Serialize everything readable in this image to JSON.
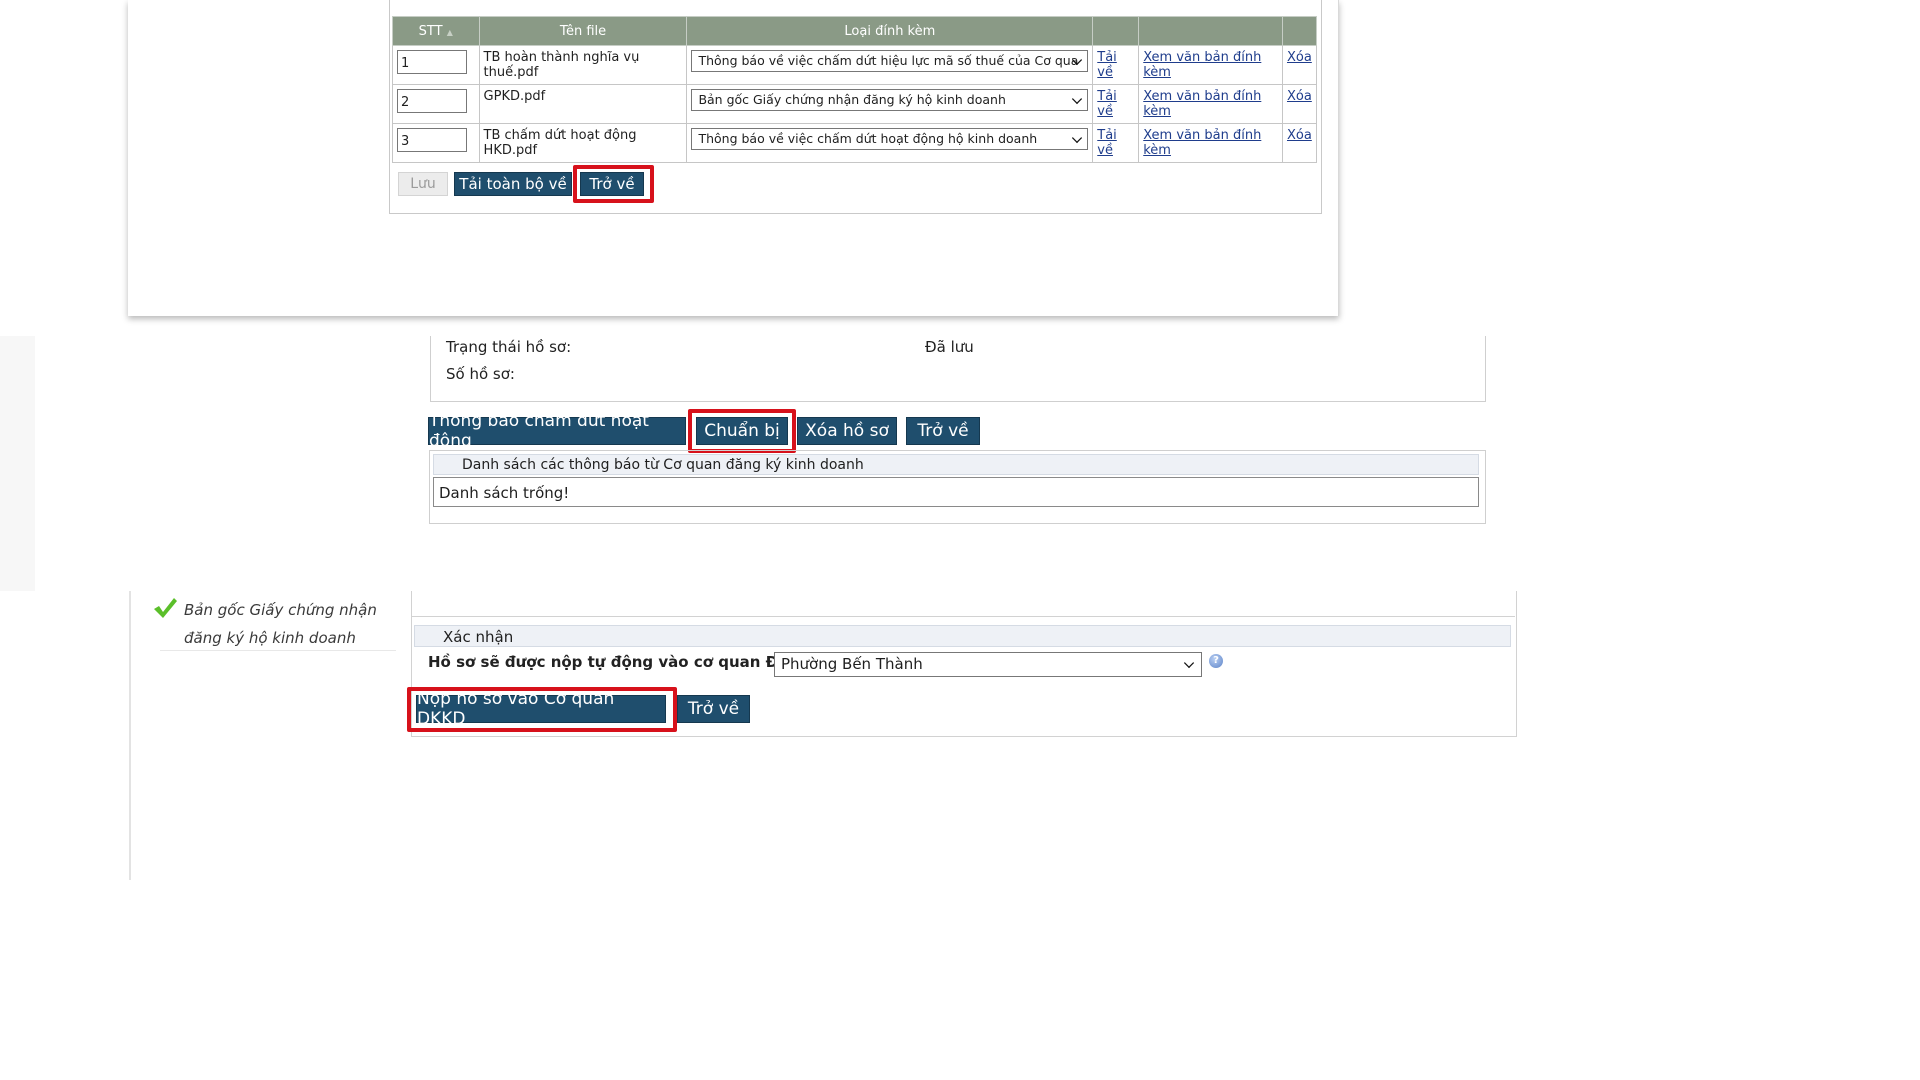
{
  "attachments": {
    "columns": [
      "STT",
      "Tên file",
      "Loại đính kèm",
      "",
      "",
      ""
    ],
    "sort_indicator": "▲",
    "rows": [
      {
        "stt": "1",
        "file": "TB hoàn thành nghĩa vụ thuế.pdf",
        "type": "Thông báo về việc chấm dứt hiệu lực mã số thuế của Cơ qua",
        "download": "Tải về",
        "view": "Xem văn bản đính kèm",
        "delete": "Xóa"
      },
      {
        "stt": "2",
        "file": "GPKD.pdf",
        "type": "Bản gốc Giấy chứng nhận đăng ký hộ kinh doanh",
        "download": "Tải về",
        "view": "Xem văn bản đính kèm",
        "delete": "Xóa"
      },
      {
        "stt": "3",
        "file": "TB chấm dứt hoạt động HKD.pdf",
        "type": "Thông báo về việc chấm dứt hoạt động hộ kinh doanh",
        "download": "Tải về",
        "view": "Xem văn bản đính kèm",
        "delete": "Xóa"
      }
    ],
    "buttons": {
      "save": "Lưu",
      "download_all": "Tải toàn bộ về",
      "back": "Trở về"
    }
  },
  "dossier": {
    "status_label": "Trạng thái hồ sơ:",
    "status_value": "Đã lưu",
    "number_label": "Số hồ sơ:",
    "buttons": {
      "notify": "Thông báo chấm dứt hoạt động",
      "prepare": "Chuẩn bị",
      "delete": "Xóa hồ sơ",
      "back": "Trở về"
    },
    "notice_list_title": "Danh sách các thông báo từ Cơ quan đăng ký kinh doanh",
    "notice_list_empty": "Danh sách trống!"
  },
  "submit": {
    "left_item_line1": "Bản gốc Giấy chứng nhận",
    "left_item_line2": "đăng ký hộ kinh doanh",
    "confirm_title": "Xác nhận",
    "authority_label": "Hồ sơ sẽ được nộp tự động vào cơ quan ĐKKD*:",
    "authority_value": "Phường Bến Thành",
    "help_icon": "?",
    "submit_button": "Nộp hồ sơ vào Cơ quan DKKD",
    "back_button": "Trở về"
  },
  "colors": {
    "button": "#1f4e6d",
    "highlight": "#d7111b",
    "table_header": "#8a9a86",
    "link": "#1f3d8c"
  }
}
